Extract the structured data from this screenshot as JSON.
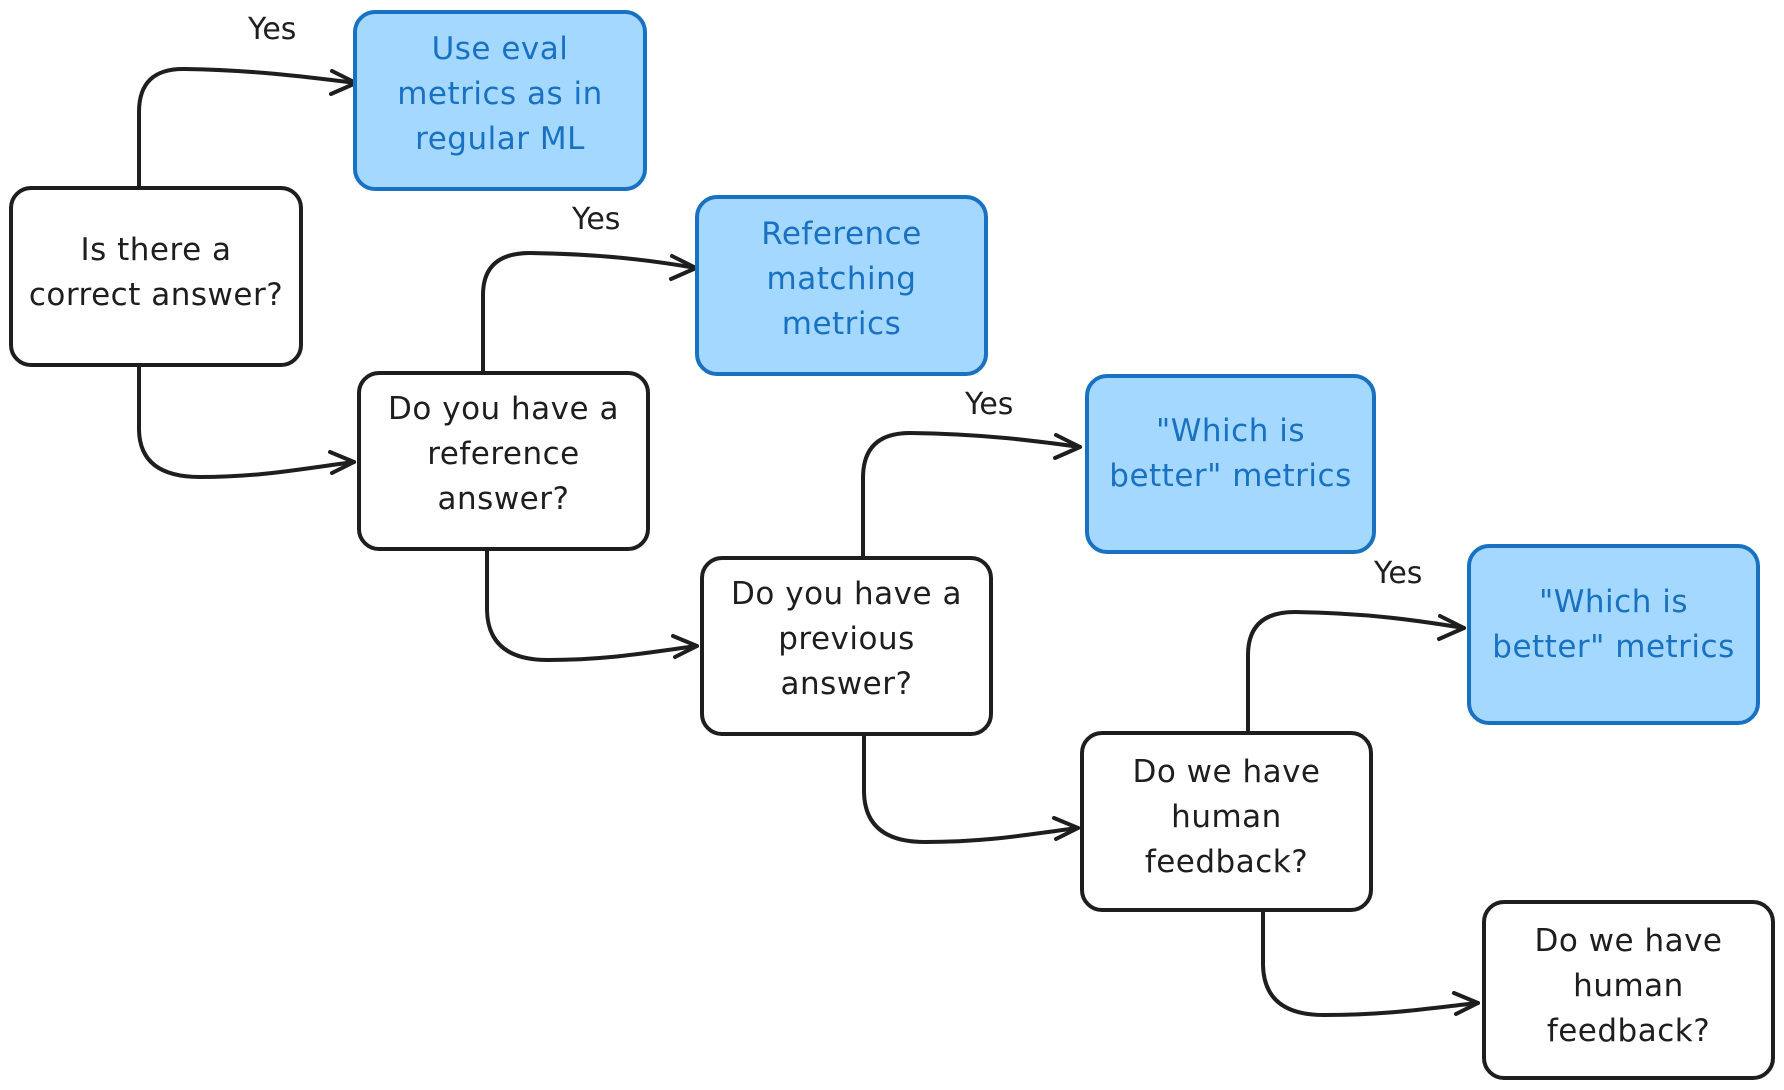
{
  "diagram": {
    "type": "decision-flowchart",
    "colors": {
      "stroke": "#1e1e1e",
      "question_fill": "#ffffff",
      "result_fill": "#a5d8ff",
      "result_stroke": "#1971c2",
      "result_text": "#1971c2"
    },
    "questions": [
      {
        "id": "q1",
        "lines": [
          "Is there a",
          "correct answer?"
        ]
      },
      {
        "id": "q2",
        "lines": [
          "Do you have a",
          "reference",
          "answer?"
        ]
      },
      {
        "id": "q3",
        "lines": [
          "Do you have a",
          "previous",
          "answer?"
        ]
      },
      {
        "id": "q4",
        "lines": [
          "Do we have",
          "human",
          "feedback?"
        ]
      },
      {
        "id": "q5",
        "lines": [
          "Do we have",
          "human",
          "feedback?"
        ]
      }
    ],
    "results": [
      {
        "id": "r1",
        "lines": [
          "Use eval",
          "metrics as in",
          "regular ML"
        ]
      },
      {
        "id": "r2",
        "lines": [
          "Reference",
          "matching",
          "metrics"
        ]
      },
      {
        "id": "r3",
        "lines": [
          "\"Which is",
          "better\" metrics"
        ]
      },
      {
        "id": "r4",
        "lines": [
          "\"Which is",
          "better\" metrics"
        ]
      }
    ],
    "edges": [
      {
        "from": "q1",
        "to": "r1",
        "label": "Yes"
      },
      {
        "from": "q1",
        "to": "q2",
        "label": ""
      },
      {
        "from": "q2",
        "to": "r2",
        "label": "Yes"
      },
      {
        "from": "q2",
        "to": "q3",
        "label": ""
      },
      {
        "from": "q3",
        "to": "r3",
        "label": "Yes"
      },
      {
        "from": "q3",
        "to": "q4",
        "label": ""
      },
      {
        "from": "q4",
        "to": "r4",
        "label": "Yes"
      },
      {
        "from": "q4",
        "to": "q5",
        "label": ""
      }
    ]
  }
}
